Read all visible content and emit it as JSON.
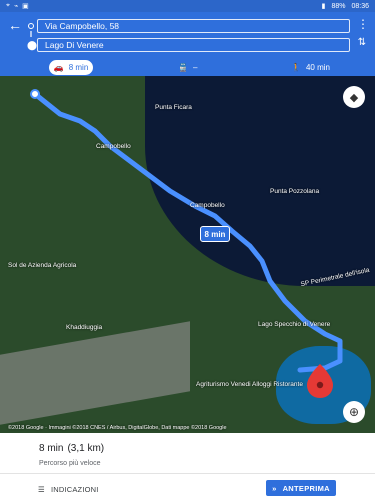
{
  "status": {
    "left_icons": [
      "location-icon",
      "wifi-icon",
      "image-icon"
    ],
    "battery": "88%",
    "time": "08:36"
  },
  "header": {
    "origin": "Via Campobello, 58",
    "destination": "Lago Di Venere",
    "modes": [
      {
        "name": "car",
        "label": "8 min",
        "icon": "car-icon"
      },
      {
        "name": "transit",
        "label": "–",
        "icon": "train-icon"
      },
      {
        "name": "walk",
        "label": "40 min",
        "icon": "walk-icon"
      }
    ]
  },
  "map": {
    "labels": [
      {
        "text": "Punta Ficara"
      },
      {
        "text": "Campobello"
      },
      {
        "text": "Campobello"
      },
      {
        "text": "Punta Pozzolana"
      },
      {
        "text": "Sol de Azienda Agricola"
      },
      {
        "text": "Khaddiuggia"
      },
      {
        "text": "Lago Specchio di Venere"
      },
      {
        "text": "Agriturismo Venedi Alloggi Ristorante"
      },
      {
        "text": "SP Perimetrale dell'isola"
      }
    ],
    "route_time_bubble": "8 min",
    "copyright": "©2018 Google · Immagini ©2018 CNES / Airbus, DigitalGlobe, Dati mappe ©2018 Google",
    "destination_pin_color": "#e53935",
    "route_color": "#4a90ff"
  },
  "sheet": {
    "time": "8 min",
    "distance": "(3,1 km)",
    "note": "Percorso più veloce",
    "steps_label": "INDICAZIONI",
    "preview_label": "ANTEPRIMA"
  }
}
